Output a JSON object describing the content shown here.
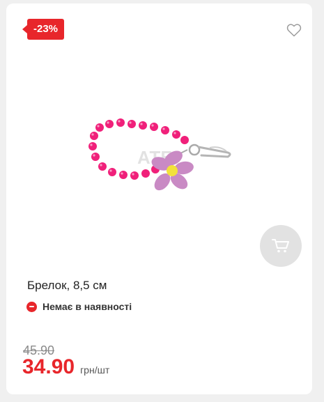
{
  "badge": {
    "discount": "-23%"
  },
  "product": {
    "title": "Брелок, 8,5 см",
    "availability": "Немає в наявності",
    "old_price": "45.90",
    "price": "34.90",
    "unit": "грн/шт",
    "image_watermark": "АТБ"
  },
  "colors": {
    "accent": "#e8262b",
    "cart_button": "#e2e2e2",
    "bead_pink": "#f0207a",
    "flower": "#c98ac4",
    "flower_center": "#f2e13b"
  },
  "icons": {
    "favorite": "heart-outline-icon",
    "cart": "shopping-cart-icon",
    "availability": "minus-circle-icon"
  }
}
